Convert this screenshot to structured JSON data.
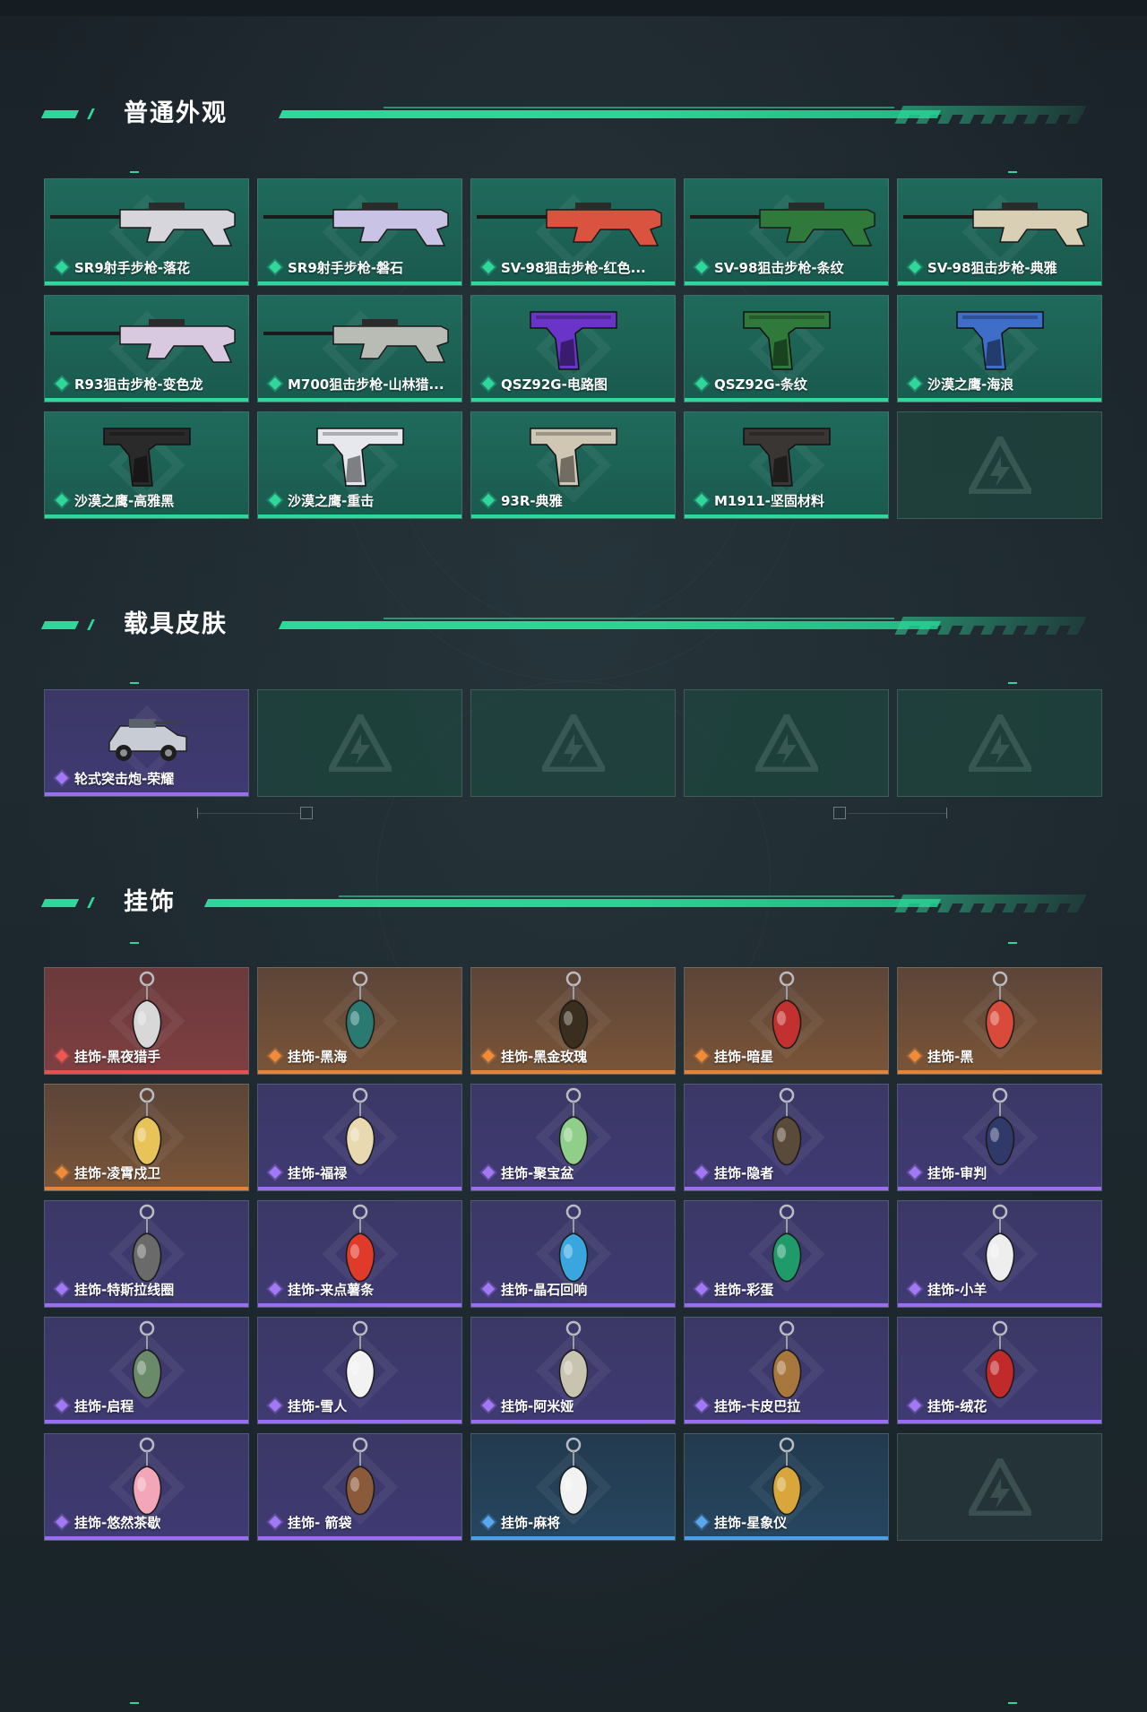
{
  "sections": [
    {
      "title": "普通外观",
      "items": [
        {
          "name": "SR9射手步枪-落花",
          "rarity": "green",
          "icon": "rifle-icon",
          "color": "#d6d6dc"
        },
        {
          "name": "SR9射手步枪-磐石",
          "rarity": "green",
          "icon": "rifle-icon",
          "color": "#c9c4e6"
        },
        {
          "name": "SV-98狙击步枪-红色...",
          "rarity": "green",
          "icon": "sniper-rifle-icon",
          "color": "#d9533f"
        },
        {
          "name": "SV-98狙击步枪-条纹",
          "rarity": "green",
          "icon": "sniper-rifle-icon",
          "color": "#2f7a3a"
        },
        {
          "name": "SV-98狙击步枪-典雅",
          "rarity": "green",
          "icon": "sniper-rifle-icon",
          "color": "#d8cfb5"
        },
        {
          "name": "R93狙击步枪-变色龙",
          "rarity": "green",
          "icon": "sniper-rifle-icon",
          "color": "#d8c8e0"
        },
        {
          "name": "M700狙击步枪-山林猎...",
          "rarity": "green",
          "icon": "sniper-rifle-icon",
          "color": "#b9bcb4"
        },
        {
          "name": "QSZ92G-电路图",
          "rarity": "green",
          "icon": "pistol-icon",
          "color": "#6a34c8"
        },
        {
          "name": "QSZ92G-条纹",
          "rarity": "green",
          "icon": "pistol-icon",
          "color": "#2f7a3a"
        },
        {
          "name": "沙漠之鹰-海浪",
          "rarity": "green",
          "icon": "pistol-icon",
          "color": "#3f6ec8"
        },
        {
          "name": "沙漠之鹰-高雅黑",
          "rarity": "green",
          "icon": "pistol-icon",
          "color": "#2a2a2a"
        },
        {
          "name": "沙漠之鹰-重击",
          "rarity": "green",
          "icon": "pistol-icon",
          "color": "#e6e8ee"
        },
        {
          "name": "93R-典雅",
          "rarity": "green",
          "icon": "pistol-icon",
          "color": "#cfc6b4"
        },
        {
          "name": "M1911-坚固材料",
          "rarity": "green",
          "icon": "pistol-icon",
          "color": "#3a3634"
        },
        {
          "name": "",
          "rarity": "empty-green",
          "icon": "logo-placeholder-icon"
        }
      ]
    },
    {
      "title": "载具皮肤",
      "items": [
        {
          "name": "轮式突击炮-荣耀",
          "rarity": "purple",
          "icon": "vehicle-icon",
          "color": "#c8ccd4"
        },
        {
          "name": "",
          "rarity": "empty-green",
          "icon": "logo-placeholder-icon"
        },
        {
          "name": "",
          "rarity": "empty-green",
          "icon": "logo-placeholder-icon"
        },
        {
          "name": "",
          "rarity": "empty-green",
          "icon": "logo-placeholder-icon"
        },
        {
          "name": "",
          "rarity": "empty-green",
          "icon": "logo-placeholder-icon"
        }
      ]
    },
    {
      "title": "挂饰",
      "items": [
        {
          "name": "挂饰-黑夜猎手",
          "rarity": "red",
          "icon": "charm-icon",
          "color": "#d8d8d8"
        },
        {
          "name": "挂饰-黑海",
          "rarity": "orange",
          "icon": "anchor-charm-icon",
          "color": "#2a7a72"
        },
        {
          "name": "挂饰-黑金玫瑰",
          "rarity": "orange",
          "icon": "charm-icon",
          "color": "#3a2e1e"
        },
        {
          "name": "挂饰-暗星",
          "rarity": "orange",
          "icon": "charm-icon",
          "color": "#c23030"
        },
        {
          "name": "挂饰-黑",
          "rarity": "orange",
          "icon": "tag-charm-icon",
          "color": "#d84a3a"
        },
        {
          "name": "挂饰-凌霄戍卫",
          "rarity": "orange",
          "icon": "charm-icon",
          "color": "#e7c35a"
        },
        {
          "name": "挂饰-福禄",
          "rarity": "purple",
          "icon": "gourd-charm-icon",
          "color": "#e8d9b0"
        },
        {
          "name": "挂饰-聚宝盆",
          "rarity": "purple",
          "icon": "bowl-charm-icon",
          "color": "#8fcf8a"
        },
        {
          "name": "挂饰-隐者",
          "rarity": "purple",
          "icon": "card-charm-icon",
          "color": "#5a4a3a"
        },
        {
          "name": "挂饰-审判",
          "rarity": "purple",
          "icon": "card-charm-icon",
          "color": "#2f3a6a"
        },
        {
          "name": "挂饰-特斯拉线圈",
          "rarity": "purple",
          "icon": "coil-charm-icon",
          "color": "#6a6a6a"
        },
        {
          "name": "挂饰-来点薯条",
          "rarity": "purple",
          "icon": "fries-charm-icon",
          "color": "#e03a2a"
        },
        {
          "name": "挂饰-晶石回响",
          "rarity": "purple",
          "icon": "crystal-charm-icon",
          "color": "#3aa6e0"
        },
        {
          "name": "挂饰-彩蛋",
          "rarity": "purple",
          "icon": "egg-charm-icon",
          "color": "#1f9a6a"
        },
        {
          "name": "挂饰-小羊",
          "rarity": "purple",
          "icon": "sheep-charm-icon",
          "color": "#eeeeee"
        },
        {
          "name": "挂饰-启程",
          "rarity": "purple",
          "icon": "ring-charm-icon",
          "color": "#6a8a6a"
        },
        {
          "name": "挂饰-雪人",
          "rarity": "purple",
          "icon": "snowman-charm-icon",
          "color": "#f2f2f2"
        },
        {
          "name": "挂饰-阿米娅",
          "rarity": "purple",
          "icon": "charm-icon",
          "color": "#c9c4b0"
        },
        {
          "name": "挂饰-卡皮巴拉",
          "rarity": "purple",
          "icon": "capybara-charm-icon",
          "color": "#a8773e"
        },
        {
          "name": "挂饰-绒花",
          "rarity": "purple",
          "icon": "flower-charm-icon",
          "color": "#c02a2a"
        },
        {
          "name": "挂饰-悠然茶歇",
          "rarity": "purple",
          "icon": "cupcake-charm-icon",
          "color": "#f2a6b8"
        },
        {
          "name": "挂饰- 箭袋",
          "rarity": "purple",
          "icon": "quiver-charm-icon",
          "color": "#8a5a3a"
        },
        {
          "name": "挂饰-麻将",
          "rarity": "blue",
          "icon": "mahjong-charm-icon",
          "color": "#f2f2f2"
        },
        {
          "name": "挂饰-星象仪",
          "rarity": "blue",
          "icon": "astrolabe-charm-icon",
          "color": "#d8a63a"
        },
        {
          "name": "",
          "rarity": "empty-slate",
          "icon": "logo-placeholder-icon"
        }
      ]
    }
  ]
}
